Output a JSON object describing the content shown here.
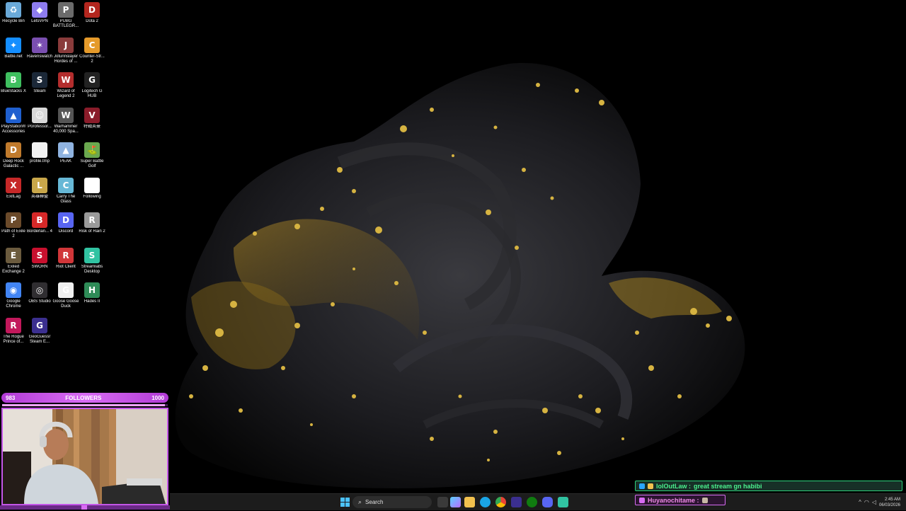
{
  "desktop": {
    "icons": [
      {
        "id": "recycle-bin",
        "label": "Recycle Bin",
        "color": "#6aa9d8",
        "glyph": "♻"
      },
      {
        "id": "letsvpn",
        "label": "LetsVPN",
        "color": "#8e7cf0",
        "glyph": "◆"
      },
      {
        "id": "pubg",
        "label": "PUBG BATTLEGR...",
        "color": "#6b6b6b",
        "glyph": "P"
      },
      {
        "id": "dota2",
        "label": "Dota 2",
        "color": "#b3261e",
        "glyph": "D"
      },
      {
        "id": "battlenet",
        "label": "Battle.net",
        "color": "#148eff",
        "glyph": "✦"
      },
      {
        "id": "ravenswatch",
        "label": "Ravenswatch",
        "color": "#7a4fb0",
        "glyph": "✶"
      },
      {
        "id": "jotunnslayer",
        "label": "Jotunnslayer Hordes of ...",
        "color": "#8a3b3b",
        "glyph": "J"
      },
      {
        "id": "counter-strike",
        "label": "Counter-Str... 2",
        "color": "#e59a2a",
        "glyph": "C"
      },
      {
        "id": "bluestacks",
        "label": "BlueStacks X",
        "color": "#3fbf5f",
        "glyph": "B"
      },
      {
        "id": "steam",
        "label": "Steam",
        "color": "#1b2838",
        "glyph": "S"
      },
      {
        "id": "wizard-of-legend",
        "label": "Wizard of Legend 2",
        "color": "#b32d2d",
        "glyph": "W"
      },
      {
        "id": "logitech",
        "label": "Logitech G HUB",
        "color": "#222222",
        "glyph": "G"
      },
      {
        "id": "ps-accessories",
        "label": "PlayStation® Accessories",
        "color": "#1f5fcf",
        "glyph": "▲"
      },
      {
        "id": "porofessor",
        "label": "Porofessor...",
        "color": "#d9d9d9",
        "glyph": "☺"
      },
      {
        "id": "warhammer",
        "label": "Warhammer 40,000 Spa...",
        "color": "#555555",
        "glyph": "W"
      },
      {
        "id": "valorant",
        "label": "特戰英豪",
        "color": "#8a1c2a",
        "glyph": "V"
      },
      {
        "id": "deep-rock",
        "label": "Deep Rock Galactic ...",
        "color": "#c07a2c",
        "glyph": "D"
      },
      {
        "id": "profile-tmp",
        "label": "profile.tmp",
        "color": "#f2f2f2",
        "glyph": " "
      },
      {
        "id": "peak",
        "label": "PEAK",
        "color": "#8fb3e0",
        "glyph": "▲"
      },
      {
        "id": "super-battle-golf",
        "label": "Super Battle Golf",
        "color": "#6aa84f",
        "glyph": "⛳"
      },
      {
        "id": "exitlag",
        "label": "ExitLag",
        "color": "#c62828",
        "glyph": "X"
      },
      {
        "id": "lol",
        "label": "英雄聯盟",
        "color": "#c9a74a",
        "glyph": "L"
      },
      {
        "id": "carry-the-glass",
        "label": "Carry The Glass",
        "color": "#67b8d6",
        "glyph": "C"
      },
      {
        "id": "following",
        "label": "Following",
        "color": "#ffffff",
        "glyph": "◎"
      },
      {
        "id": "path-of-exile",
        "label": "Path of Exile 2",
        "color": "#6b4a2a",
        "glyph": "P"
      },
      {
        "id": "borderlands",
        "label": "Borderlan... 4",
        "color": "#d62828",
        "glyph": "B"
      },
      {
        "id": "discord",
        "label": "Discord",
        "color": "#5865f2",
        "glyph": "D"
      },
      {
        "id": "risk-of-rain",
        "label": "Risk of Rain 2",
        "color": "#9a9a9a",
        "glyph": "R"
      },
      {
        "id": "exiled-exchange",
        "label": "Exiled Exchange 2",
        "color": "#6b5b3e",
        "glyph": "E"
      },
      {
        "id": "sworn",
        "label": "SWORN",
        "color": "#c8102e",
        "glyph": "S"
      },
      {
        "id": "riot-client",
        "label": "Riot Client",
        "color": "#d13639",
        "glyph": "R"
      },
      {
        "id": "streamlabs",
        "label": "Streamlabs Desktop",
        "color": "#31c3a2",
        "glyph": "S"
      },
      {
        "id": "chrome",
        "label": "Google Chrome",
        "color": "#4285f4",
        "glyph": "◉"
      },
      {
        "id": "obs",
        "label": "OBS Studio",
        "color": "#302e31",
        "glyph": "◎"
      },
      {
        "id": "goose-goose-duck",
        "label": "Goose Goose Duck",
        "color": "#f0f0f0",
        "glyph": "G"
      },
      {
        "id": "hades2",
        "label": "Hades II",
        "color": "#2e8b57",
        "glyph": "H"
      },
      {
        "id": "rogue-prince",
        "label": "The Rogue Prince of...",
        "color": "#c2185b",
        "glyph": "R"
      },
      {
        "id": "geoguessr",
        "label": "GeoGuessr Steam E...",
        "color": "#3b2f8f",
        "glyph": "G"
      }
    ]
  },
  "overlay": {
    "followers_current": "983",
    "followers_label": "FOLLOWERS",
    "followers_goal": "1000",
    "followers_progress": 0.983
  },
  "chat": [
    {
      "user": "lolOutLaw :",
      "text": "great stream gn habibi",
      "color": "#4bf08e"
    },
    {
      "user": "Huyanochitame :",
      "text": "",
      "color": "#f08ae8"
    }
  ],
  "taskbar": {
    "search_label": "Search",
    "clock_time": "2:45 AM",
    "clock_date": "06/03/2026"
  }
}
